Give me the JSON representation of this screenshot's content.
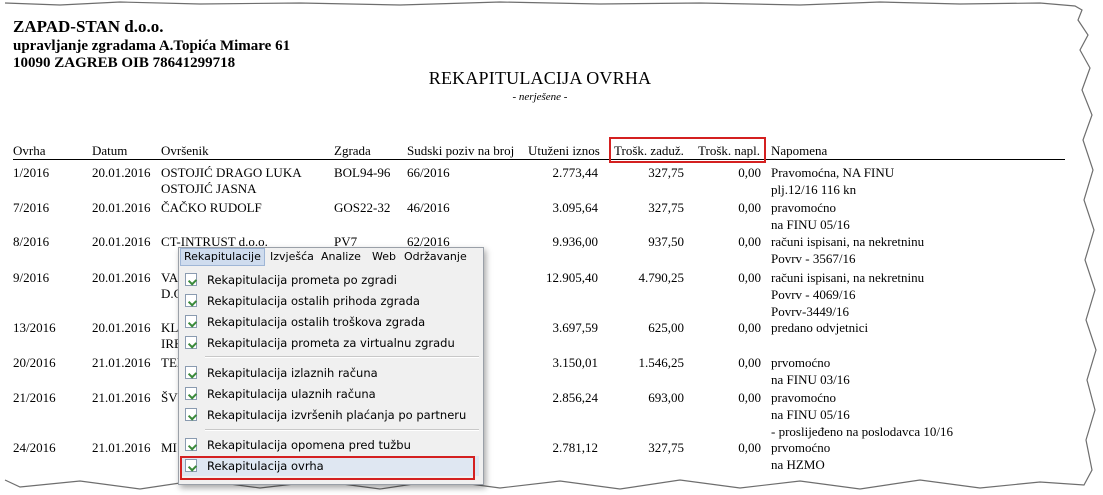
{
  "header": {
    "company": "ZAPAD-STAN d.o.o.",
    "address": "upravljanje zgradama A.Topića Mimare 61",
    "city_oib": "10090 ZAGREB    OIB 78641299718"
  },
  "report": {
    "title": "REKAPITULACIJA OVRHA",
    "subtitle": "- nerješene -"
  },
  "columns": [
    "Ovrha",
    "Datum",
    "Ovršenik",
    "Zgrada",
    "Sudski poziv na broj",
    "Utuženi iznos",
    "Trošk. zaduž.",
    "Trošk. napl.",
    "Napomena"
  ],
  "rows": [
    {
      "ovrha": "1/2016",
      "datum": "20.01.2016",
      "ovrsenik": [
        "OSTOJIĆ DRAGO LUKA",
        "OSTOJIĆ JASNA"
      ],
      "zgrada": "BOL94-96",
      "poziv": "66/2016",
      "iznos": "2.773,44",
      "zaduz": "327,75",
      "napl": "0,00",
      "napomena": [
        "Pravomoćna, NA FINU",
        "plj.12/16  116 kn"
      ]
    },
    {
      "ovrha": "7/2016",
      "datum": "20.01.2016",
      "ovrsenik": [
        "ČAČKO RUDOLF"
      ],
      "zgrada": "GOS22-32",
      "poziv": "46/2016",
      "iznos": "3.095,64",
      "zaduz": "327,75",
      "napl": "0,00",
      "napomena": [
        "pravomoćno",
        "na FINU 05/16"
      ]
    },
    {
      "ovrha": "8/2016",
      "datum": "20.01.2016",
      "ovrsenik": [
        "CT-INTRUST d.o.o."
      ],
      "zgrada": "PV7",
      "poziv": "62/2016",
      "iznos": "9.936,00",
      "zaduz": "937,50",
      "napl": "0,00",
      "napomena": [
        "računi ispisani, na nekretninu",
        "Povrv - 3567/16"
      ]
    },
    {
      "ovrha": "9/2016",
      "datum": "20.01.2016",
      "ovrsenik": [
        "VA",
        "D.C"
      ],
      "zgrada": "",
      "poziv": "",
      "iznos": "12.905,40",
      "zaduz": "4.790,25",
      "napl": "0,00",
      "napomena": [
        "računi ispisani, na nekretninu",
        "Povrv - 4069/16",
        "Povrv-3449/16"
      ]
    },
    {
      "ovrha": "13/2016",
      "datum": "20.01.2016",
      "ovrsenik": [
        "KL",
        "IRE"
      ],
      "zgrada": "",
      "poziv": "",
      "iznos": "3.697,59",
      "zaduz": "625,00",
      "napl": "0,00",
      "napomena": [
        "predano odvjetnici"
      ]
    },
    {
      "ovrha": "20/2016",
      "datum": "21.01.2016",
      "ovrsenik": [
        "TEI"
      ],
      "zgrada": "",
      "poziv": "",
      "iznos": "3.150,01",
      "zaduz": "1.546,25",
      "napl": "0,00",
      "napomena": [
        "prvomoćno",
        "na FINU 03/16"
      ]
    },
    {
      "ovrha": "21/2016",
      "datum": "21.01.2016",
      "ovrsenik": [
        "ŠVI"
      ],
      "zgrada": "",
      "poziv": "",
      "iznos": "2.856,24",
      "zaduz": "693,00",
      "napl": "0,00",
      "napomena": [
        "pravomoćno",
        "na FINU 05/16",
        "- proslijeđeno na poslodavca 10/16"
      ]
    },
    {
      "ovrha": "24/2016",
      "datum": "21.01.2016",
      "ovrsenik": [
        "MI"
      ],
      "zgrada": "",
      "poziv": "",
      "iznos": "2.781,12",
      "zaduz": "327,75",
      "napl": "0,00",
      "napomena": [
        "prvomoćno",
        "na HZMO"
      ]
    }
  ],
  "menu": {
    "bar": [
      "Rekapitulacije",
      "Izvješća",
      "Analize",
      "Web",
      "Održavanje"
    ],
    "group1": [
      "Rekapitulacija prometa po zgradi",
      "Rekapitulacija ostalih prihoda zgrada",
      "Rekapitulacija ostalih troškova zgrada",
      "Rekapitulacija prometa za virtualnu zgradu"
    ],
    "group2": [
      "Rekapitulacija izlaznih računa",
      "Rekapitulacija ulaznih računa",
      "Rekapitulacija izvršenih plaćanja po partneru"
    ],
    "group3": [
      "Rekapitulacija opomena pred tužbu",
      "Rekapitulacija ovrha"
    ],
    "icon": "document-check-icon"
  },
  "highlight_color": "#d42020"
}
